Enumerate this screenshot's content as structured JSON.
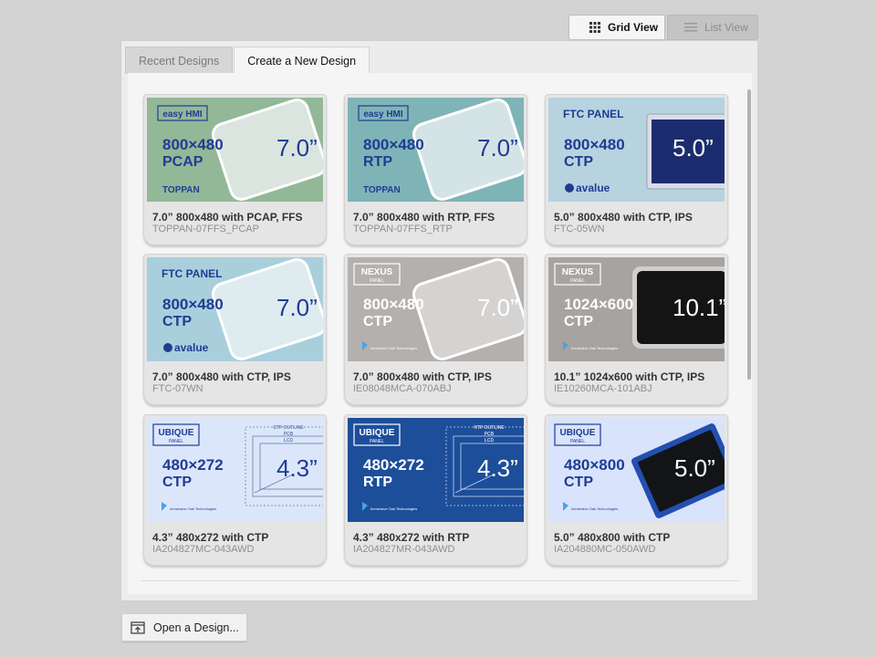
{
  "view_toggle": {
    "grid_label": "Grid View",
    "list_label": "List View",
    "grid_icon": "grid-icon",
    "list_icon": "list-icon",
    "active": "grid"
  },
  "tabs": [
    {
      "label": "Recent Designs",
      "active": false
    },
    {
      "label": "Create a New Design",
      "active": true
    }
  ],
  "cards": [
    {
      "title": "7.0” 800x480 with PCAP, FFS",
      "subtitle": "TOPPAN-07FFS_PCAP",
      "thumb": {
        "brand": "easy HMI",
        "resolution": "800×480",
        "touch": "PCAP",
        "size": "7.0”",
        "maker": "TOPPAN",
        "bg": "#93b898",
        "text_color": "#1f3c93"
      }
    },
    {
      "title": "7.0” 800x480 with RTP, FFS",
      "subtitle": "TOPPAN-07FFS_RTP",
      "thumb": {
        "brand": "easy HMI",
        "resolution": "800×480",
        "touch": "RTP",
        "size": "7.0”",
        "maker": "TOPPAN",
        "bg": "#7fb4b6",
        "text_color": "#1f3c93"
      }
    },
    {
      "title": "5.0” 800x480 with CTP, IPS",
      "subtitle": "FTC-05WN",
      "thumb": {
        "brand": "FTC PANEL",
        "resolution": "800×480",
        "touch": "CTP",
        "size": "5.0”",
        "maker": "avalue",
        "bg": "#b7d3e0",
        "text_color": "#1f3c93"
      }
    },
    {
      "title": "7.0” 800x480 with CTP, IPS",
      "subtitle": "FTC-07WN",
      "thumb": {
        "brand": "FTC PANEL",
        "resolution": "800×480",
        "touch": "CTP",
        "size": "7.0”",
        "maker": "avalue",
        "bg": "#a9cfdc",
        "text_color": "#1f3c93"
      }
    },
    {
      "title": "7.0” 800x480 with CTP, IPS",
      "subtitle": "IE08048MCA-070ABJ",
      "thumb": {
        "brand": "NEXUS",
        "brand_sub": "PANEL",
        "resolution": "800×480",
        "touch": "CTP",
        "size": "7.0”",
        "maker": "Immersive Oak Technologies",
        "bg": "#b4b0ad",
        "text_color": "#ffffff"
      }
    },
    {
      "title": "10.1” 1024x600 with CTP, IPS",
      "subtitle": "IE10260MCA-101ABJ",
      "thumb": {
        "brand": "NEXUS",
        "brand_sub": "PANEL",
        "resolution": "1024×600",
        "touch": "CTP",
        "size": "10.1”",
        "maker": "Immersive Oak Technologies",
        "bg": "#a7a3a0",
        "text_color": "#ffffff"
      }
    },
    {
      "title": "4.3” 480x272 with CTP",
      "subtitle": "IA204827MC-043AWD",
      "thumb": {
        "brand": "UBIQUE",
        "brand_sub": "PANEL",
        "resolution": "480×272",
        "touch": "CTP",
        "size": "4.3”",
        "maker": "Immersive Oak Technologies",
        "bg": "#dce6fb",
        "text_color": "#1f3c93",
        "outline_labels": [
          "CTP OUTLINE",
          "PCB",
          "LCD"
        ]
      }
    },
    {
      "title": "4.3” 480x272 with RTP",
      "subtitle": "IA204827MR-043AWD",
      "thumb": {
        "brand": "UBIQUE",
        "brand_sub": "PANEL",
        "resolution": "480×272",
        "touch": "RTP",
        "size": "4.3”",
        "maker": "Immersive Oak Technologies",
        "bg": "#1d4e9a",
        "text_color": "#ffffff",
        "outline_labels": [
          "RTP OUTLINE",
          "PCB",
          "LCD"
        ]
      }
    },
    {
      "title": "5.0” 480x800 with CTP",
      "subtitle": "IA204880MC-050AWD",
      "thumb": {
        "brand": "UBIQUE",
        "brand_sub": "PANEL",
        "resolution": "480×800",
        "touch": "CTP",
        "size": "5.0”",
        "maker": "Immersive Oak Technologies",
        "bg": "#d9e3fb",
        "text_color": "#1f3c93"
      }
    }
  ],
  "open_button": {
    "label": "Open a Design...",
    "icon": "open-file-icon"
  }
}
